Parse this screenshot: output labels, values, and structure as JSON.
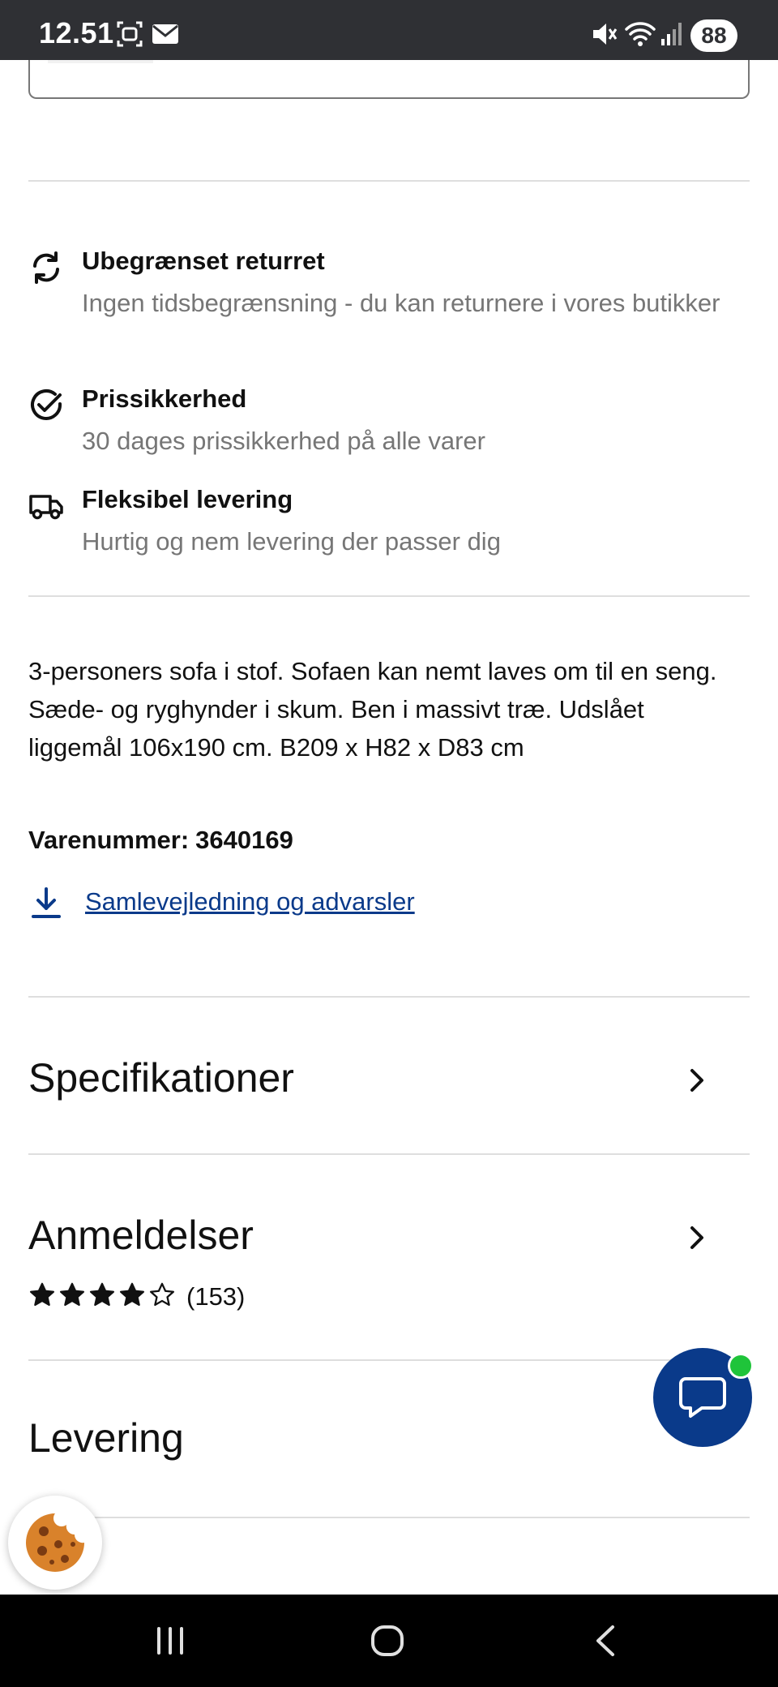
{
  "status_bar": {
    "time": "12.51",
    "battery": "88"
  },
  "usps": [
    {
      "icon": "refresh-icon",
      "title": "Ubegrænset returret",
      "desc": "Ingen tidsbegrænsning - du kan returnere i vores butikker"
    },
    {
      "icon": "check-circle-icon",
      "title": "Prissikkerhed",
      "desc": "30 dages prissikkerhed på alle varer"
    },
    {
      "icon": "truck-icon",
      "title": "Fleksibel levering",
      "desc": "Hurtig og nem levering der passer dig"
    }
  ],
  "product": {
    "description": "3-personers sofa i stof. Sofaen kan nemt laves om til en seng. Sæde- og ryghynder i skum. Ben i massivt træ. Udslået liggemål 106x190 cm. B209 x H82 x D83 cm",
    "sku_label": "Varenummer:",
    "sku_value": "3640169",
    "doc_link": "Samlevejledning og advarsler"
  },
  "sections": {
    "specs": "Specifikationer",
    "reviews": "Anmeldelser",
    "reviews_count": "(153)",
    "reviews_rating": 4,
    "reviews_max": 5,
    "delivery": "Levering"
  },
  "colors": {
    "brand_blue": "#0a3a8a",
    "online_green": "#1fc43a",
    "cookie_orange": "#d9822b"
  }
}
